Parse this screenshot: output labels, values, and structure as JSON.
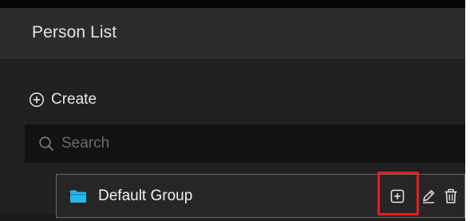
{
  "header": {
    "title": "Person List"
  },
  "create": {
    "label": "Create",
    "icon": "plus-circle-icon"
  },
  "search": {
    "placeholder": "Search",
    "value": "",
    "icon": "search-icon"
  },
  "groups": [
    {
      "label": "Default Group",
      "icon": "folder-icon",
      "icon_color": "#29b6e8",
      "actions": [
        {
          "name": "add",
          "icon": "add-square-icon",
          "highlighted": true
        },
        {
          "name": "edit",
          "icon": "pencil-icon"
        },
        {
          "name": "delete",
          "icon": "trash-icon"
        }
      ]
    }
  ],
  "colors": {
    "highlight": "#e41e1e",
    "panel_bg": "#202020",
    "header_bg": "#2c2c2c",
    "search_bg": "#121212",
    "folder": "#29b6e8"
  }
}
